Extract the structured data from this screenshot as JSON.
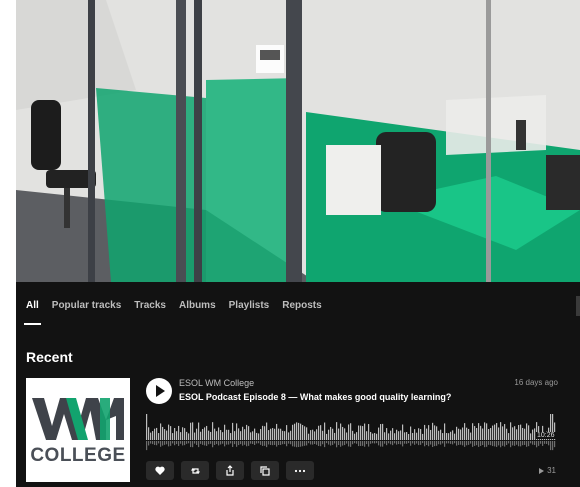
{
  "banner": {
    "image": "office-glass-rooms-photo"
  },
  "tabs": [
    {
      "label": "All",
      "active": true
    },
    {
      "label": "Popular tracks",
      "active": false
    },
    {
      "label": "Tracks",
      "active": false
    },
    {
      "label": "Albums",
      "active": false
    },
    {
      "label": "Playlists",
      "active": false
    },
    {
      "label": "Reposts",
      "active": false
    }
  ],
  "section": {
    "title": "Recent"
  },
  "track": {
    "artwork_text": "COLLEGE",
    "artist": "ESOL WM College",
    "title": "ESOL Podcast Episode 8 — What makes good quality learning?",
    "posted": "16 days ago",
    "duration": "10:26",
    "plays": "31"
  },
  "actions": [
    {
      "name": "like-button",
      "icon": "heart-icon"
    },
    {
      "name": "repost-button",
      "icon": "repost-icon"
    },
    {
      "name": "share-button",
      "icon": "share-icon"
    },
    {
      "name": "copy-link-button",
      "icon": "copy-icon"
    },
    {
      "name": "more-button",
      "icon": "more-icon"
    }
  ],
  "colors": {
    "background": "#121212",
    "accent_green": "#0fa56f",
    "text": "#ffffff",
    "muted": "#bdbdbd"
  }
}
